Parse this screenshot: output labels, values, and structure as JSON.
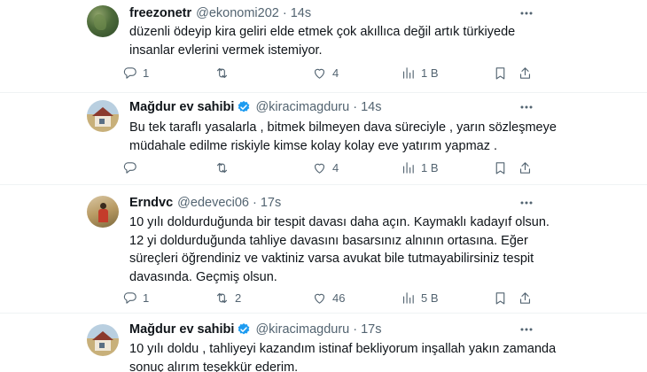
{
  "tweets": [
    {
      "name": "freezonetr",
      "handle": "@ekonomi202",
      "separator": "·",
      "time": "14s",
      "verified": false,
      "lines": [
        "düzenli ödeyip kira geliri elde etmek çok akıllıca değil artık türkiyede",
        "insanlar evlerini vermek istemiyor."
      ],
      "replies": "1",
      "reposts": "",
      "likes": "4",
      "views": "1 B"
    },
    {
      "name": "Mağdur ev sahibi",
      "handle": "@kiracimagduru",
      "separator": "·",
      "time": "14s",
      "verified": true,
      "lines": [
        "Bu tek taraflı yasalarla , bitmek bilmeyen dava süreciyle , yarın sözleşmeye",
        "müdahale edilme riskiyle kimse kolay kolay eve yatırım yapmaz ."
      ],
      "replies": "",
      "reposts": "",
      "likes": "4",
      "views": "1 B"
    },
    {
      "name": "Erndvc",
      "handle": "@edeveci06",
      "separator": "·",
      "time": "17s",
      "verified": false,
      "lines": [
        "10 yılı doldurduğunda bir tespit davası daha açın. Kaymaklı kadayıf olsun.",
        "12 yi doldurduğunda tahliye davasını basarsınız alnının ortasına. Eğer",
        "süreçleri öğrendiniz ve vaktiniz varsa avukat bile tutmayabilirsiniz tespit",
        "davasında. Geçmiş olsun."
      ],
      "replies": "1",
      "reposts": "2",
      "likes": "46",
      "views": "5 B"
    },
    {
      "name": "Mağdur ev sahibi",
      "handle": "@kiracimagduru",
      "separator": "·",
      "time": "17s",
      "verified": true,
      "lines": [
        "10 yılı doldu , tahliyeyi kazandım istinaf bekliyorum inşallah yakın zamanda",
        "sonuç alırım teşekkür ederim."
      ]
    }
  ],
  "colors": {
    "text": "#0f1419",
    "muted": "#536471",
    "verified": "#1d9bf0",
    "divider": "#eff3f4"
  },
  "icons": [
    "more-icon",
    "reply-icon",
    "repost-icon",
    "like-icon",
    "views-icon",
    "bookmark-icon",
    "share-icon",
    "verified-badge-icon"
  ]
}
